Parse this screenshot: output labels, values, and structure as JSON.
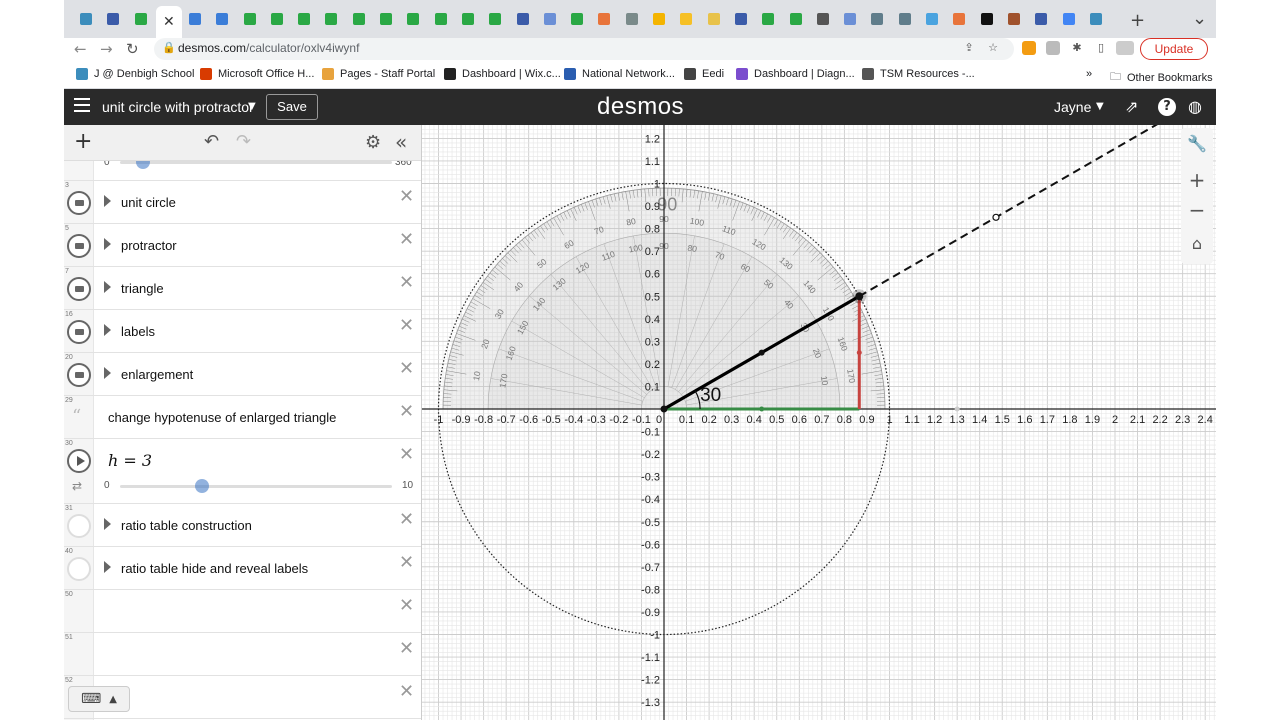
{
  "browser": {
    "tabs_count": 38,
    "active_tab_close": "✕",
    "new_tab": "+",
    "tab_menu": "⌄",
    "url_host": "desmos.com",
    "url_path": "/calculator/oxlv4iwynf",
    "update_label": "Update",
    "bookmarks": [
      {
        "label": "J @ Denbigh School",
        "color": "#3c8dbc"
      },
      {
        "label": "Microsoft Office H...",
        "color": "#d83b01"
      },
      {
        "label": "Pages - Staff Portal",
        "color": "#e8a33d"
      },
      {
        "label": "Dashboard | Wix.c...",
        "color": "#222222"
      },
      {
        "label": "National Network...",
        "color": "#2a5db0"
      },
      {
        "label": "Eedi",
        "color": "#444444"
      },
      {
        "label": "Dashboard | Diagn...",
        "color": "#7b4dce"
      },
      {
        "label": "TSM Resources -...",
        "color": "#555555"
      }
    ],
    "bookmarks_more": "»",
    "other_bookmarks": "Other Bookmarks"
  },
  "header": {
    "graph_title": "unit circle with protractor",
    "save_label": "Save",
    "logo": "desmos",
    "user": "Jayne"
  },
  "expressions": {
    "top_slider": {
      "min": "0",
      "max": "360"
    },
    "rows": [
      {
        "num": "3",
        "type": "folder",
        "label": "unit circle"
      },
      {
        "num": "5",
        "type": "folder",
        "label": "protractor"
      },
      {
        "num": "7",
        "type": "folder",
        "label": "triangle"
      },
      {
        "num": "16",
        "type": "folder",
        "label": "labels"
      },
      {
        "num": "20",
        "type": "folder",
        "label": "enlargement"
      },
      {
        "num": "29",
        "type": "note",
        "label": "change hypotenuse of enlarged triangle"
      },
      {
        "num": "30",
        "type": "slider",
        "label": "h = 3",
        "min": "0",
        "max": "10",
        "value": 3
      },
      {
        "num": "31",
        "type": "folder-hidden",
        "label": "ratio table construction"
      },
      {
        "num": "40",
        "type": "folder-hidden",
        "label": "ratio table hide and reveal labels"
      },
      {
        "num": "50",
        "type": "empty",
        "label": ""
      },
      {
        "num": "51",
        "type": "empty",
        "label": ""
      },
      {
        "num": "52",
        "type": "empty",
        "label": ""
      }
    ]
  },
  "graph": {
    "x_ticks": [
      "-1",
      "-0.9",
      "-0.8",
      "-0.7",
      "-0.6",
      "-0.5",
      "-0.4",
      "-0.3",
      "-0.2",
      "-0.1",
      "0",
      "0.1",
      "0.2",
      "0.3",
      "0.4",
      "0.5",
      "0.6",
      "0.7",
      "0.8",
      "0.9",
      "1",
      "1.1",
      "1.2",
      "1.3",
      "1.4",
      "1.5",
      "1.6",
      "1.7",
      "1.8",
      "1.9",
      "2",
      "2.1",
      "2.2",
      "2.3",
      "2.4"
    ],
    "y_ticks": [
      "1.2",
      "1.1",
      "1",
      "0.9",
      "0.8",
      "0.7",
      "0.6",
      "0.5",
      "0.4",
      "0.3",
      "0.2",
      "0.1",
      "-0.1",
      "-0.2",
      "-0.3",
      "-0.4",
      "-0.5",
      "-0.6",
      "-0.7",
      "-0.8",
      "-0.9",
      "-1",
      "-1.1",
      "-1.2",
      "-1.3"
    ],
    "angle_label": "30",
    "ninety_label": "90",
    "angle_deg": 30,
    "colors": {
      "hyp": "#000000",
      "opp": "#c74440",
      "adj": "#388c46",
      "grid": "#e6e6e6",
      "grid_major": "#cccccc"
    }
  }
}
